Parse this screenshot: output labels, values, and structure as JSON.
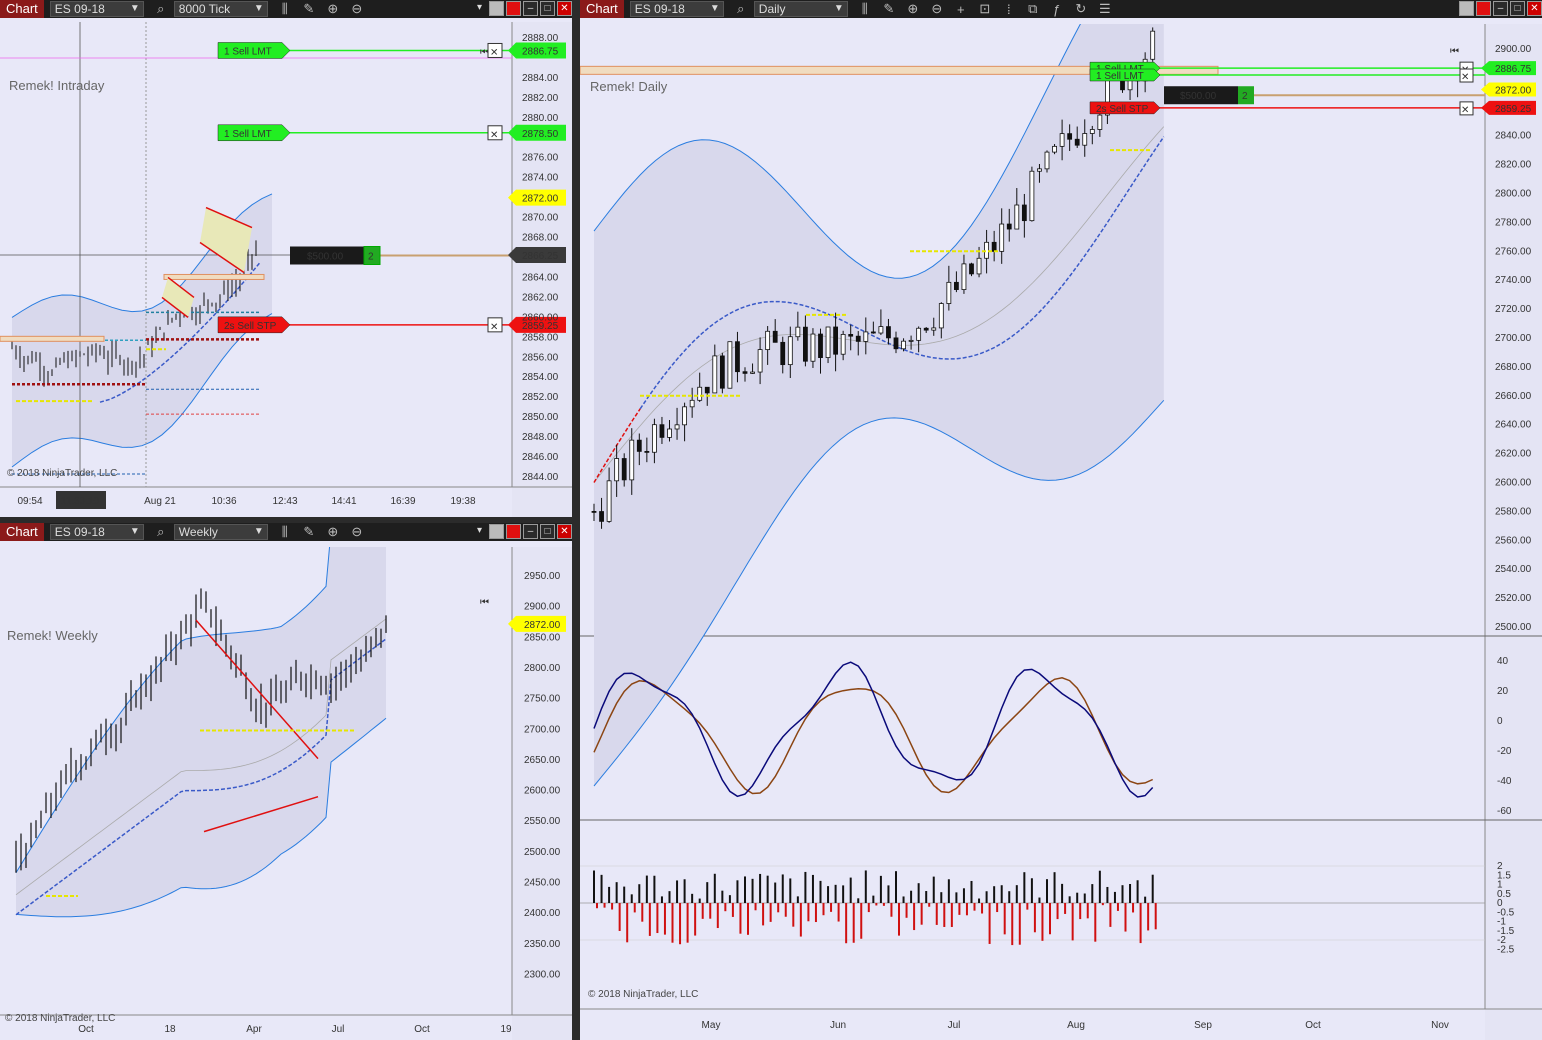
{
  "colors": {
    "buy_green": "#22ee22",
    "sell_red": "#ee1111",
    "price_yellow": "#ffff00",
    "band_blue": "#2a7de0",
    "ma_blue": "#3a5ac8",
    "osc_navy": "#0a0a7a",
    "osc_brown": "#8b4513",
    "bg": "#e8e8f8"
  },
  "common": {
    "chart_tab": "Chart",
    "instrument": "ES 09-18",
    "copyright": "© 2018 NinjaTrader, LLC"
  },
  "intraday": {
    "interval": "8000 Tick",
    "label": "Remek! Intraday",
    "prices": [
      "2888.00",
      "2886.75",
      "2884.00",
      "2882.00",
      "2880.00",
      "2878.50",
      "2876.00",
      "2874.00",
      "2872.00",
      "2870.00",
      "2868.00",
      "2866.25",
      "2864.00",
      "2862.00",
      "2860.00",
      "2859.25",
      "2858.00",
      "2856.00",
      "2854.00",
      "2852.00",
      "2850.00",
      "2848.00",
      "2846.00",
      "2844.00"
    ],
    "times": [
      "09:54",
      "11:33:10",
      "Aug 21",
      "10:36",
      "12:43",
      "14:41",
      "16:39",
      "19:38"
    ],
    "orders": [
      {
        "qty": "1",
        "type": "Sell LMT",
        "price": "2886.75"
      },
      {
        "qty": "1",
        "type": "Sell LMT",
        "price": "2878.50"
      },
      {
        "qty": "2s",
        "type": "Sell STP",
        "price": "2859.25"
      }
    ],
    "position": {
      "pnl": "$500.00",
      "qty": "2"
    },
    "last": "2872.00",
    "crosshair_price": "2866.25"
  },
  "weekly": {
    "interval": "Weekly",
    "label": "Remek! Weekly",
    "prices": [
      "2950.00",
      "2900.00",
      "2872.00",
      "2850.00",
      "2800.00",
      "2750.00",
      "2700.00",
      "2650.00",
      "2600.00",
      "2550.00",
      "2500.00",
      "2450.00",
      "2400.00",
      "2350.00",
      "2300.00"
    ],
    "dates": [
      "Oct",
      "18",
      "Apr",
      "Jul",
      "Oct",
      "19"
    ],
    "last": "2872.00"
  },
  "daily": {
    "interval": "Daily",
    "label": "Remek! Daily",
    "prices": [
      "2900.00",
      "2886.75",
      "2872.00",
      "2859.25",
      "2840.00",
      "2820.00",
      "2800.00",
      "2780.00",
      "2760.00",
      "2740.00",
      "2720.00",
      "2700.00",
      "2680.00",
      "2660.00",
      "2640.00",
      "2620.00",
      "2600.00",
      "2580.00",
      "2560.00",
      "2540.00",
      "2520.00",
      "2500.00"
    ],
    "osc_ticks": [
      "40",
      "20",
      "0",
      "-20",
      "-40",
      "-60"
    ],
    "hist_ticks": [
      "2",
      "1.5",
      "1",
      "0.5",
      "0",
      "-0.5",
      "-1",
      "-1.5",
      "-2",
      "-2.5"
    ],
    "dates": [
      "May",
      "Jun",
      "Jul",
      "Aug",
      "Sep",
      "Oct",
      "Nov"
    ],
    "orders": [
      {
        "qty": "1",
        "type": "Sell LMT",
        "price": "2886.75"
      },
      {
        "qty": "1",
        "type": "Sell LMT",
        "price": "2886.75"
      },
      {
        "qty": "2s",
        "type": "Sell STP",
        "price": "2859.25"
      }
    ],
    "position": {
      "pnl": "$500.00",
      "qty": "2"
    },
    "last": "2872.00"
  }
}
